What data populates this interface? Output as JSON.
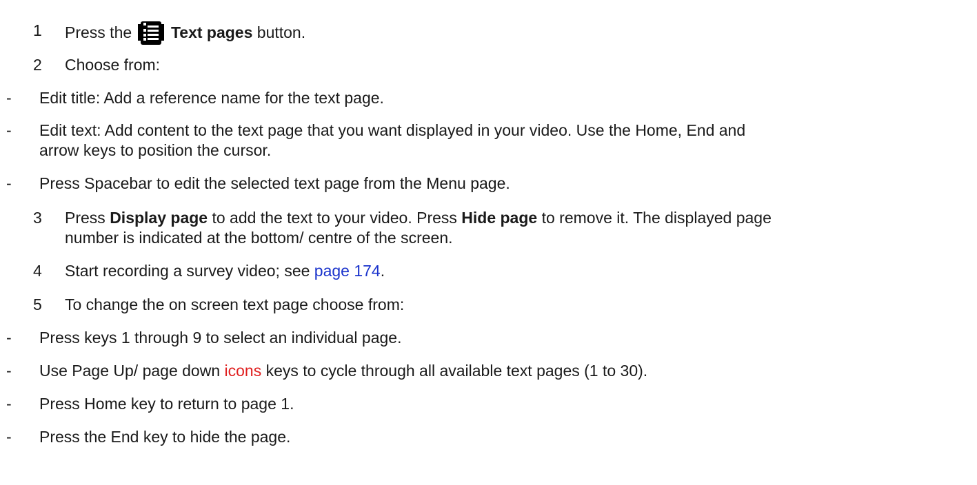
{
  "steps": [
    {
      "num": "1",
      "pre": "Press the",
      "bold": "Text pages",
      "post": "button.",
      "icon": "text-pages-icon"
    },
    {
      "num": "2",
      "text": "Choose from:"
    },
    {
      "num": "3",
      "pre": "Press",
      "bold1": "Display page",
      "mid": "to add the text to your video. Press",
      "bold2": "Hide page",
      "post": "to remove it. The displayed page",
      "line2": "number is indicated at the bottom/ centre of the screen."
    },
    {
      "num": "4",
      "pre": "Start recording a survey video; see",
      "link": "page 174",
      "post": "."
    },
    {
      "num": "5",
      "text": "To change the on screen text page choose from:"
    }
  ],
  "bullets_a": [
    {
      "dash": "-",
      "text": "Edit title: Add a reference name for the text page."
    },
    {
      "dash": "-",
      "text": "Edit text: Add content to the text page that you want displayed in your video. Use the Home, End and",
      "line2": "arrow keys to position the cursor."
    },
    {
      "dash": "-",
      "text": "Press Spacebar to edit the selected text page from the Menu page."
    }
  ],
  "bullets_b": [
    {
      "dash": "-",
      "text": "Press keys 1 through 9 to select an individual page."
    },
    {
      "dash": "-",
      "pre": "Use Page Up/ page down",
      "highlight": "icons",
      "post": "keys to cycle through all available text pages (1 to 30)."
    },
    {
      "dash": "-",
      "text": "Press Home key to return to page 1."
    },
    {
      "dash": "-",
      "text": "Press the End key to hide the page."
    }
  ],
  "colors": {
    "link": "#1a33cc",
    "highlight": "#e02020"
  }
}
